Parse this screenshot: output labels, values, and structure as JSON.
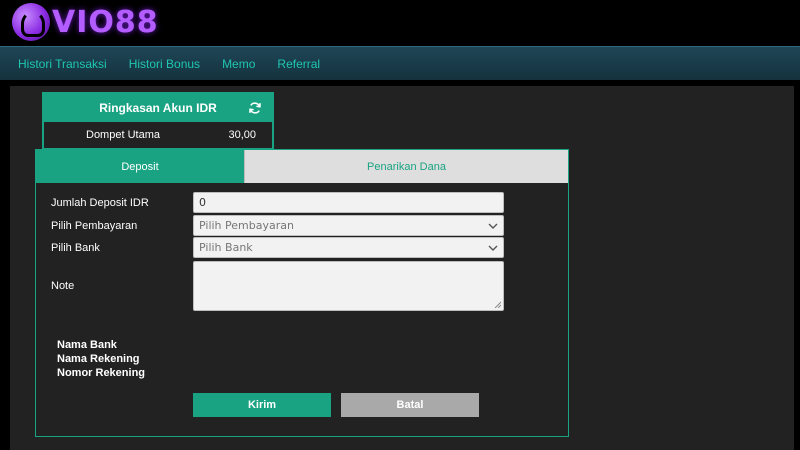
{
  "brand": {
    "logo_text": "VIO88",
    "accent": "#1aa383",
    "logo_color": "#b35cff"
  },
  "nav": {
    "items": [
      {
        "label": "Histori Transaksi"
      },
      {
        "label": "Histori Bonus"
      },
      {
        "label": "Memo"
      },
      {
        "label": "Referral"
      }
    ]
  },
  "summary": {
    "title": "Ringkasan Akun IDR",
    "refresh_icon": "refresh-icon",
    "wallet_label": "Dompet Utama",
    "wallet_value": "30,00"
  },
  "tabs": {
    "deposit": "Deposit",
    "withdraw": "Penarikan Dana",
    "active": "deposit"
  },
  "form": {
    "amount_label": "Jumlah Deposit IDR",
    "amount_value": "0",
    "payment_label": "Pilih Pembayaran",
    "payment_value": "Pilih Pembayaran",
    "bank_label": "Pilih Bank",
    "bank_value": "Pilih Bank",
    "note_label": "Note"
  },
  "bank_info": {
    "bank_name_label": "Nama Bank",
    "account_name_label": "Nama Rekening",
    "account_number_label": "Nomor Rekening"
  },
  "buttons": {
    "submit": "Kirim",
    "cancel": "Batal"
  }
}
